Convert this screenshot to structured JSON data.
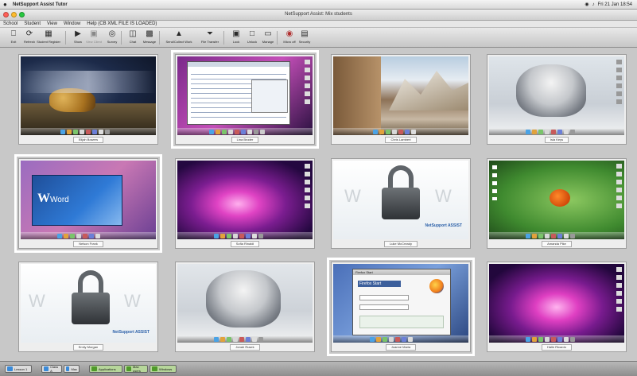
{
  "menubar": {
    "title": "NetSupport Assist Tutor",
    "clock": "Fri 21 Jan 18:54"
  },
  "window": {
    "title": "NetSupport Assist: Mix students"
  },
  "app_menu": [
    "School",
    "Student",
    "View",
    "Window",
    "Help (CB XML FILE IS LOADED)"
  ],
  "toolbar": {
    "exit": "Exit",
    "refresh": "Refresh",
    "student_register": "Student Register",
    "show": "Show",
    "view_client": "View Client",
    "survey": "Survey",
    "chat": "Chat",
    "message": "Message",
    "send_collect": "Send/Collect Work",
    "file_transfer": "File Transfer",
    "lock": "Lock",
    "unlock": "Unlock",
    "manage": "Manage",
    "nfi": "Micro off",
    "security": "Security"
  },
  "students": [
    {
      "name": "Elijah Bowers",
      "screen": "leopard",
      "selected": false
    },
    {
      "name": "Lina Broder",
      "screen": "spreadsheet",
      "selected": true
    },
    {
      "name": "Chris Lambert",
      "screen": "mountains",
      "selected": false
    },
    {
      "name": "Isla Keys",
      "screen": "snowleopard",
      "selected": false
    },
    {
      "name": "Nelson Frank",
      "screen": "word",
      "selected": true
    },
    {
      "name": "Sofia Rinaldi",
      "screen": "aurora",
      "selected": false
    },
    {
      "name": "Luke McCready",
      "screen": "locked",
      "selected": false
    },
    {
      "name": "Amanda Pike",
      "screen": "ladybug",
      "selected": false
    },
    {
      "name": "Emily Morgan",
      "screen": "locked",
      "selected": false
    },
    {
      "name": "Jonah Rusek",
      "screen": "snowleopard2",
      "selected": false
    },
    {
      "name": "Joanne Maria",
      "screen": "firefox",
      "selected": true
    },
    {
      "name": "Halle Ricardo",
      "screen": "aurora2",
      "selected": false
    }
  ],
  "lock_screen": {
    "letters": [
      "W",
      "W",
      "W"
    ],
    "brand": "NetSupport ASSIST"
  },
  "firefox_window": {
    "title": "Firefox Start",
    "heading": "Firefox Start"
  },
  "word_splash": {
    "text": "Word"
  },
  "statusbar": {
    "items": [
      "Lesson 1",
      "Class A",
      "Mac",
      "Applications",
      "Mac users",
      "Windows"
    ]
  },
  "colors": {
    "selection": "#ffffff",
    "background": "#c8c8c8"
  }
}
